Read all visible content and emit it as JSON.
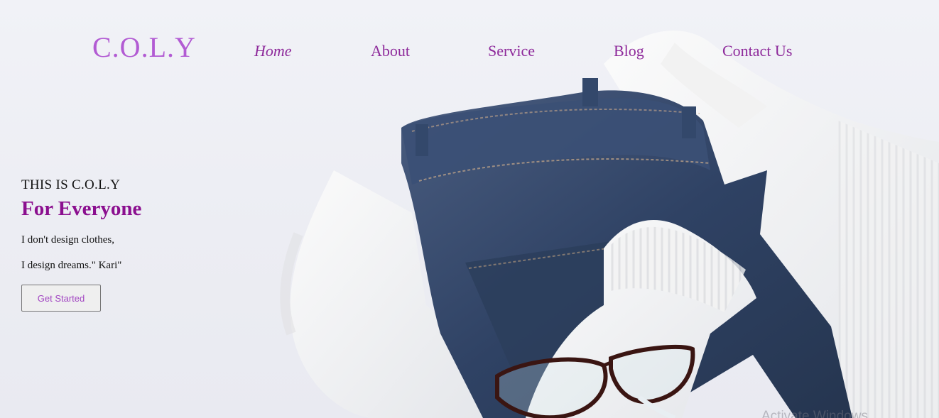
{
  "brand": {
    "logo": "C.O.L.Y"
  },
  "nav": {
    "items": [
      {
        "label": "Home",
        "active": true
      },
      {
        "label": "About"
      },
      {
        "label": "Service"
      },
      {
        "label": "Blog"
      },
      {
        "label": "Contact Us"
      }
    ]
  },
  "hero": {
    "eyebrow": "THIS IS C.O.L.Y",
    "headline": "For Everyone",
    "quote_line1": "I don't design clothes,",
    "quote_line2": "I design dreams.\" Kari\"",
    "cta_label": "Get Started",
    "image_description_icon": "clothes-photo"
  },
  "os_overlay": {
    "activation_text": "Activate Windows"
  },
  "colors": {
    "logo": "#b25bd3",
    "nav_link": "#8e2a9b",
    "headline": "#8b0f8f",
    "cta_text": "#a246c2"
  }
}
